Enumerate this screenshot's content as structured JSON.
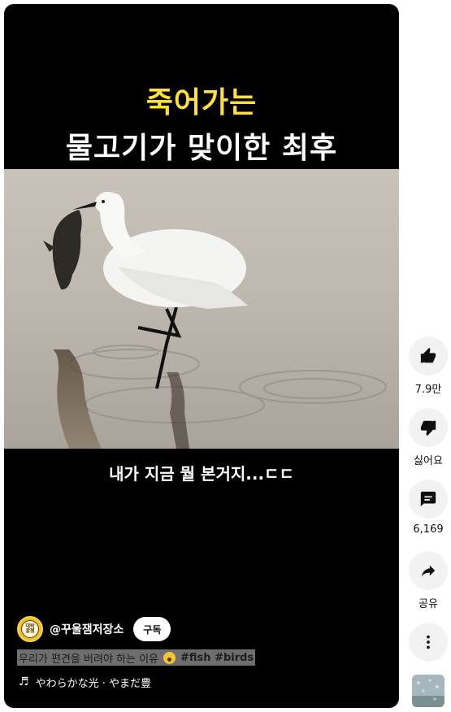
{
  "video": {
    "title_line1": "죽어가는",
    "title_line2": "물고기가 맞이한 최후",
    "caption": "내가 지금 뭘 본거지...ㄷㄷ",
    "title_color": "#ffe03a",
    "scene_icon": "egret-with-fish-image"
  },
  "channel": {
    "name": "@꾸울잼저장소",
    "avatar_text_line1": "대박",
    "avatar_text_line2": "꿀잼",
    "subscribe_label": "구독"
  },
  "description": {
    "text": "우리가 편견을 버려야 하는 이유",
    "emoji": "astonished-face-emoji",
    "tags": "#fish #birds"
  },
  "music": {
    "icon": "music-note-icon",
    "text": "やわらかな光 · やまだ豊"
  },
  "actions": {
    "like_count": "7.9만",
    "dislike_label": "싫어요",
    "comment_count": "6,169",
    "share_label": "공유"
  }
}
